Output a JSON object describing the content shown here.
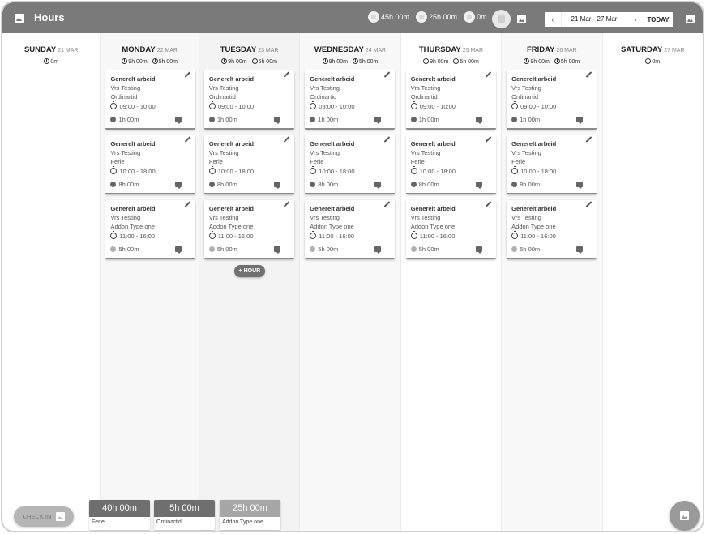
{
  "header": {
    "title": "Hours",
    "summary": [
      {
        "icon": "hours-total-icon",
        "value": "45h 00m"
      },
      {
        "icon": "hours-type-icon",
        "value": "25h 00m"
      },
      {
        "icon": "hours-other-icon",
        "value": "0m"
      }
    ],
    "date_nav": {
      "prev_label": "‹",
      "range": "21 Mar  -  27 Mar",
      "next_label": "›",
      "today_label": "TODAY"
    }
  },
  "days": [
    {
      "name": "SUNDAY",
      "date": "21 MAR",
      "totals": [
        "0m"
      ],
      "entries": []
    },
    {
      "name": "MONDAY",
      "date": "22 MAR",
      "totals": [
        "9h 00m",
        "5h 00m"
      ],
      "entries": [
        {
          "title": "Generelt arbeid",
          "project": "Vrs Testing",
          "type": "Ordinartid",
          "time": "09:00 - 10:00",
          "duration": "1h 00m"
        },
        {
          "title": "Generelt arbeid",
          "project": "Vrs Testing",
          "type": "Ferie",
          "time": "10:00 - 18:00",
          "duration": "8h 00m"
        },
        {
          "title": "Generelt arbeid",
          "project": "Vrs Testing",
          "type": "Addon Type one",
          "time": "11:00 - 16:00",
          "duration": "5h 00m"
        }
      ]
    },
    {
      "name": "TUESDAY",
      "date": "23 MAR",
      "totals": [
        "9h 00m",
        "5h 00m"
      ],
      "entries": [
        {
          "title": "Generelt arbeid",
          "project": "Vrs Testing",
          "type": "Ordinartid",
          "time": "09:00 - 10:00",
          "duration": "1h 00m"
        },
        {
          "title": "Generelt arbeid",
          "project": "Vrs Testing",
          "type": "Ferie",
          "time": "10:00 - 18:00",
          "duration": "8h 00m"
        },
        {
          "title": "Generelt arbeid",
          "project": "Vrs Testing",
          "type": "Addon Type one",
          "time": "11:00 - 16:00",
          "duration": "5h 00m"
        }
      ],
      "add_label": "+ HOUR"
    },
    {
      "name": "WEDNESDAY",
      "date": "24 MAR",
      "totals": [
        "9h 00m",
        "5h 00m"
      ],
      "entries": [
        {
          "title": "Generelt arbeid",
          "project": "Vrs Testing",
          "type": "Ordinartid",
          "time": "09:00 - 10:00",
          "duration": "1h 00m"
        },
        {
          "title": "Generelt arbeid",
          "project": "Vrs Testing",
          "type": "Ferie",
          "time": "10:00 - 18:00",
          "duration": "8h 00m"
        },
        {
          "title": "Generelt arbeid",
          "project": "Vrs Testing",
          "type": "Addon Type one",
          "time": "11:00 - 16:00",
          "duration": "5h 00m"
        }
      ]
    },
    {
      "name": "THURSDAY",
      "date": "25 MAR",
      "totals": [
        "9h 00m",
        "5h 00m"
      ],
      "entries": [
        {
          "title": "Generelt arbeid",
          "project": "Vrs Testing",
          "type": "Ordinartid",
          "time": "09:00 - 10:00",
          "duration": "1h 00m"
        },
        {
          "title": "Generelt arbeid",
          "project": "Vrs Testing",
          "type": "Ferie",
          "time": "10:00 - 18:00",
          "duration": "8h 00m"
        },
        {
          "title": "Generelt arbeid",
          "project": "Vrs Testing",
          "type": "Addon Type one",
          "time": "11:00 - 16:00",
          "duration": "5h 00m"
        }
      ]
    },
    {
      "name": "FRIDAY",
      "date": "26 MAR",
      "totals": [
        "9h 00m",
        "5h 00m"
      ],
      "entries": [
        {
          "title": "Generelt arbeid",
          "project": "Vrs Testing",
          "type": "Ordinartid",
          "time": "09:00 - 10:00",
          "duration": "1h 00m"
        },
        {
          "title": "Generelt arbeid",
          "project": "Vrs Testing",
          "type": "Ferie",
          "time": "10:00 - 18:00",
          "duration": "8h 00m"
        },
        {
          "title": "Generelt arbeid",
          "project": "Vrs Testing",
          "type": "Addon Type one",
          "time": "11:00 - 16:00",
          "duration": "5h 00m"
        }
      ]
    },
    {
      "name": "SATURDAY",
      "date": "27 MAR",
      "totals": [
        "0m"
      ],
      "entries": []
    }
  ],
  "footer": {
    "checkin_label": "CHECK IN",
    "legend": [
      {
        "value": "40h 00m",
        "label": "Ferie",
        "color": "#6f6f6f"
      },
      {
        "value": "5h 00m",
        "label": "Ordinartid",
        "color": "#6f6f6f"
      },
      {
        "value": "25h 00m",
        "label": "Addon Type one",
        "color": "#a6a6a6"
      }
    ]
  },
  "colors": {
    "header_bg": "#7a7a7a",
    "column_bg": [
      "#ffffff",
      "#f7f7f7",
      "#f3f3f3",
      "#f8f8f8",
      "#ffffff",
      "#f8f8f8",
      "#ffffff"
    ]
  }
}
